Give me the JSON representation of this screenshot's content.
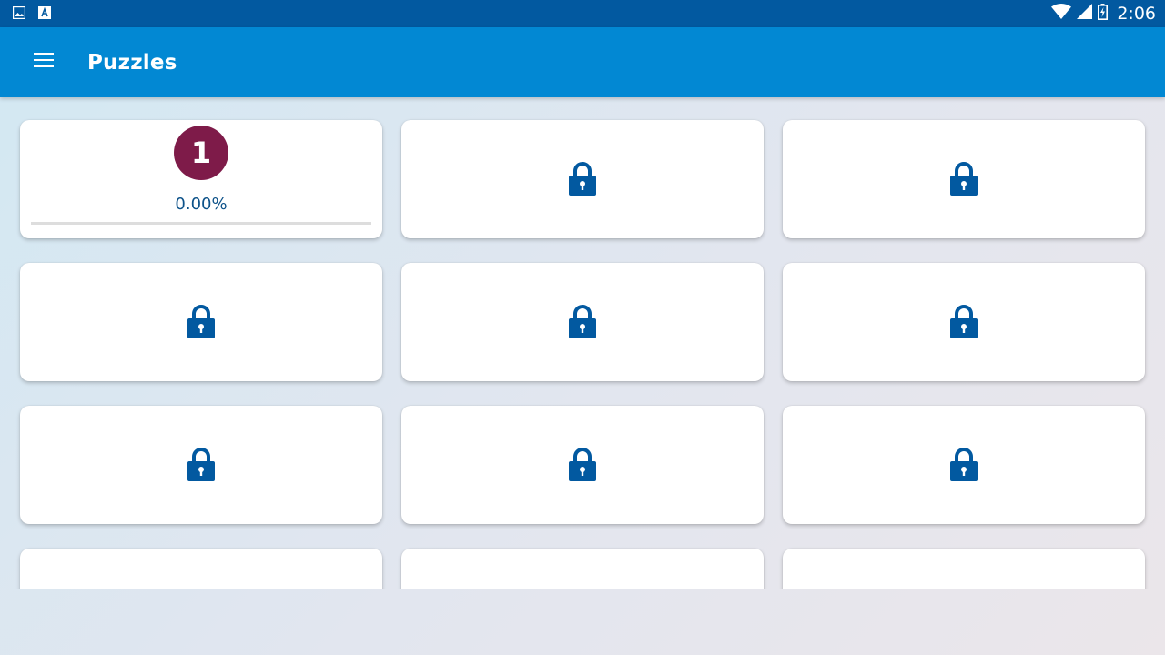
{
  "status_bar": {
    "left_icons": [
      "image-icon",
      "keyboard-a-icon"
    ],
    "right_icons": [
      "wifi-icon",
      "cell-signal-icon",
      "battery-charging-icon"
    ],
    "time": "2:06"
  },
  "app_bar": {
    "menu_icon": "menu-icon",
    "title": "Puzzles"
  },
  "colors": {
    "status_bar": "#0259a0",
    "app_bar": "#0288d3",
    "badge": "#7e1b49",
    "lock": "#0259a0",
    "progress_text": "#0d5289"
  },
  "puzzles": [
    {
      "level": "1",
      "locked": false,
      "progress_text": "0.00%",
      "progress": 0
    },
    {
      "locked": true,
      "icon": "lock-icon"
    },
    {
      "locked": true,
      "icon": "lock-icon"
    },
    {
      "locked": true,
      "icon": "lock-icon"
    },
    {
      "locked": true,
      "icon": "lock-icon"
    },
    {
      "locked": true,
      "icon": "lock-icon"
    },
    {
      "locked": true,
      "icon": "lock-icon"
    },
    {
      "locked": true,
      "icon": "lock-icon"
    },
    {
      "locked": true,
      "icon": "lock-icon"
    },
    {
      "locked": true
    },
    {
      "locked": true
    },
    {
      "locked": true
    }
  ]
}
